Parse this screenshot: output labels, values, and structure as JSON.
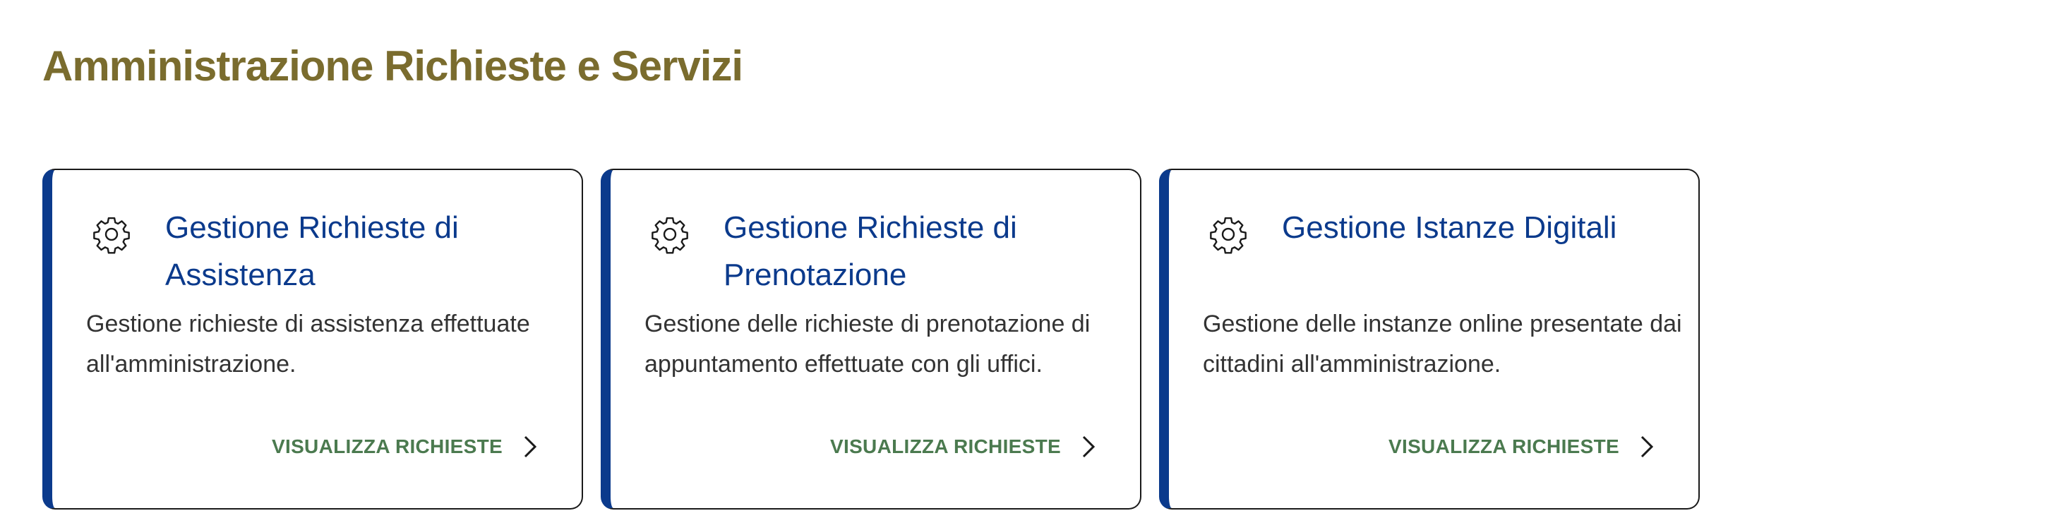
{
  "colors": {
    "title": "#7a6c2e",
    "card_heading": "#0b3a8c",
    "card_accent": "#0b3a8c",
    "link": "#4b7a4f",
    "text": "#333333"
  },
  "page": {
    "title": "Amministrazione Richieste e Servizi"
  },
  "cards": [
    {
      "icon": "gear-icon",
      "title": "Gestione Richieste di Assistenza",
      "description": "Gestione richieste di assistenza effettuate all'amministrazione.",
      "action_label": "VISUALIZZA RICHIESTE",
      "action_icon": "chevron-right-icon"
    },
    {
      "icon": "gear-icon",
      "title": "Gestione Richieste di Prenotazione",
      "description": "Gestione delle richieste di prenotazione di appuntamento effettuate con gli uffici.",
      "action_label": "VISUALIZZA RICHIESTE",
      "action_icon": "chevron-right-icon"
    },
    {
      "icon": "gear-icon",
      "title": "Gestione Istanze Digitali",
      "description": "Gestione delle instanze online presentate dai cittadini all'amministrazione.",
      "action_label": "VISUALIZZA RICHIESTE",
      "action_icon": "chevron-right-icon"
    }
  ]
}
